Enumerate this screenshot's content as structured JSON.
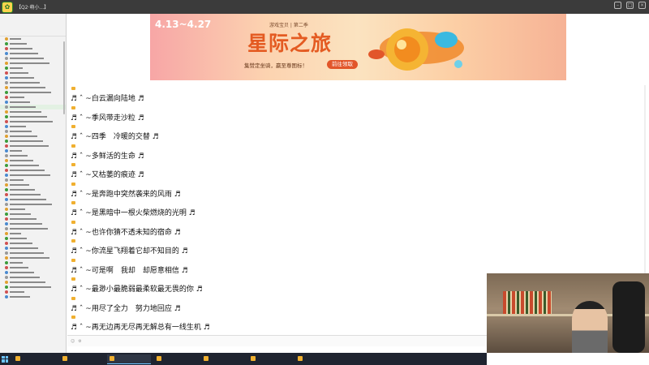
{
  "window": {
    "title": "【Q2·萌小...】",
    "controls": [
      "minimize-icon",
      "maximize-icon",
      "close-icon"
    ]
  },
  "banner": {
    "date_range": "4.13~4.27",
    "season": "游戏宝贝 | 第二季",
    "headline": "星际之旅",
    "tagline": "集赞定坐骑，赢至尊图标！",
    "cta": "前往领取"
  },
  "chat": {
    "messages": [
      {
        "text": "♬ ˆ ~白云漏向陆地 ♬"
      },
      {
        "text": "♬ ˆ ~季风带走沙粒 ♬"
      },
      {
        "text": "♬ ˆ ~四季　冷暖的交替 ♬"
      },
      {
        "text": "♬ ˆ ~多鲜活的生命 ♬"
      },
      {
        "text": "♬ ˆ ~又枯萎的痕迹 ♬"
      },
      {
        "text": "♬ ˆ ~是奔跑中突然袭来的风雨 ♬"
      },
      {
        "text": "♬ ˆ ~是黑暗中一根火柴燃烧的光明 ♬"
      },
      {
        "text": "♬ ˆ ~也许你猜不透未知的宿命 ♬"
      },
      {
        "text": "♬ ˆ ~你流星飞翔着它却不知目的 ♬"
      },
      {
        "text": "♬ ˆ ~可是啊　我却　却愿意相信 ♬"
      },
      {
        "text": "♬ ˆ ~最渺小最脆弱最柔软最无畏的你 ♬"
      },
      {
        "text": "♬ ˆ ~用尽了全力　努力地回应 ♬"
      },
      {
        "text": "♬ ˆ ~再无边再无尽再无解总有一线生机 ♬"
      }
    ]
  },
  "taskbar": {
    "items": [
      {
        "label": ""
      },
      {
        "label": ""
      },
      {
        "label": ""
      },
      {
        "label": ""
      },
      {
        "label": ""
      },
      {
        "label": ""
      },
      {
        "label": ""
      }
    ]
  },
  "colors": {
    "banner_accent": "#e45b22",
    "cta_bg": "#e2562a",
    "titlebar_bg": "#3b3b3b",
    "taskbar_bg": "#1f2430"
  }
}
